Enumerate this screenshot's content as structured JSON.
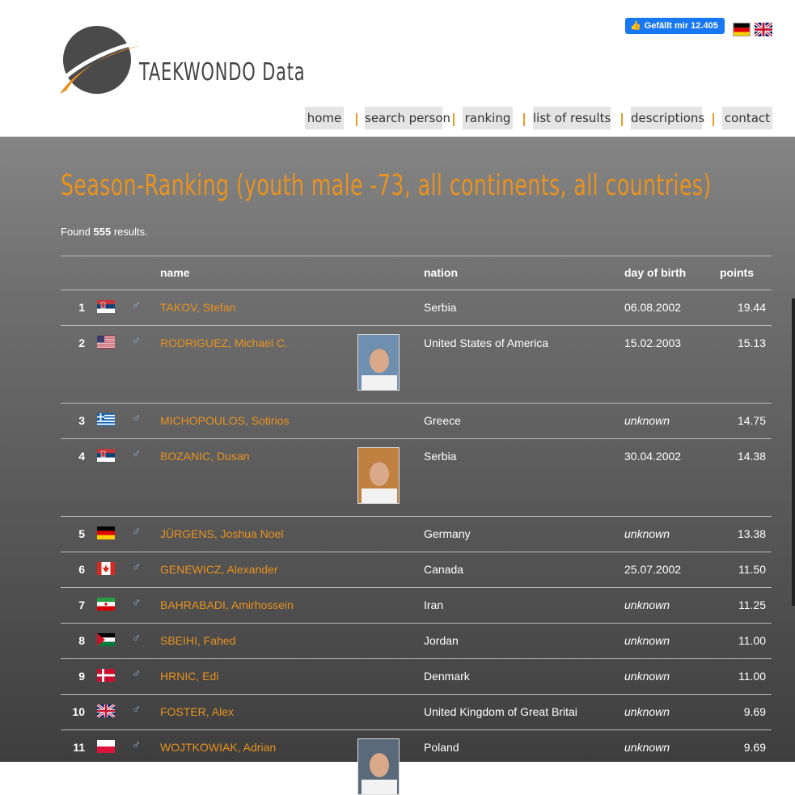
{
  "header": {
    "logo_text": "TAEKWONDO Data",
    "facebook_like": "Gefällt mir 12.405",
    "nav": [
      "home",
      "search person",
      "ranking",
      "list of results",
      "descriptions",
      "contact"
    ]
  },
  "page": {
    "title": "Season-Ranking (youth male -73, all continents, all countries)",
    "found_prefix": "Found",
    "found_count": "555",
    "found_suffix": "results."
  },
  "table": {
    "columns": {
      "name": "name",
      "nation": "nation",
      "dob": "day of birth",
      "points": "points"
    },
    "rows": [
      {
        "rank": "1",
        "flag": "serbia-flag",
        "gender": "♂",
        "name": "TAKOV, Stefan",
        "nation": "Serbia",
        "dob": "06.08.2002",
        "points": "19.44"
      },
      {
        "rank": "2",
        "flag": "usa-flag",
        "gender": "♂",
        "name": "RODRIGUEZ, Michael C.",
        "nation": "United States of America",
        "dob": "15.02.2003",
        "points": "15.13"
      },
      {
        "rank": "3",
        "flag": "greece-flag",
        "gender": "♂",
        "name": "MICHOPOULOS, Sotirios",
        "nation": "Greece",
        "dob": "unknown",
        "points": "14.75"
      },
      {
        "rank": "4",
        "flag": "serbia-flag",
        "gender": "♂",
        "name": "BOZANIC, Dusan",
        "nation": "Serbia",
        "dob": "30.04.2002",
        "points": "14.38"
      },
      {
        "rank": "5",
        "flag": "germany-flag",
        "gender": "♂",
        "name": "JÜRGENS, Joshua Noel",
        "nation": "Germany",
        "dob": "unknown",
        "points": "13.38"
      },
      {
        "rank": "6",
        "flag": "canada-flag",
        "gender": "♂",
        "name": "GENEWICZ, Alexander",
        "nation": "Canada",
        "dob": "25.07.2002",
        "points": "11.50"
      },
      {
        "rank": "7",
        "flag": "iran-flag",
        "gender": "♂",
        "name": "BAHRABADI, Amirhossein",
        "nation": "Iran",
        "dob": "unknown",
        "points": "11.25"
      },
      {
        "rank": "8",
        "flag": "jordan-flag",
        "gender": "♂",
        "name": "SBEIHI, Fahed",
        "nation": "Jordan",
        "dob": "unknown",
        "points": "11.00"
      },
      {
        "rank": "9",
        "flag": "denmark-flag",
        "gender": "♂",
        "name": "HRNIC, Edi",
        "nation": "Denmark",
        "dob": "unknown",
        "points": "11.00"
      },
      {
        "rank": "10",
        "flag": "uk-flag",
        "gender": "♂",
        "name": "FOSTER, Alex",
        "nation": "United Kingdom of Great Britai",
        "dob": "unknown",
        "points": "9.69"
      },
      {
        "rank": "11",
        "flag": "poland-flag",
        "gender": "♂",
        "name": "WOJTKOWIAK, Adrian",
        "nation": "Poland",
        "dob": "unknown",
        "points": "9.69"
      }
    ]
  },
  "colors": {
    "accent": "#e8921f",
    "link": "#e8921f",
    "nav_bg": "#e4e4e4"
  }
}
